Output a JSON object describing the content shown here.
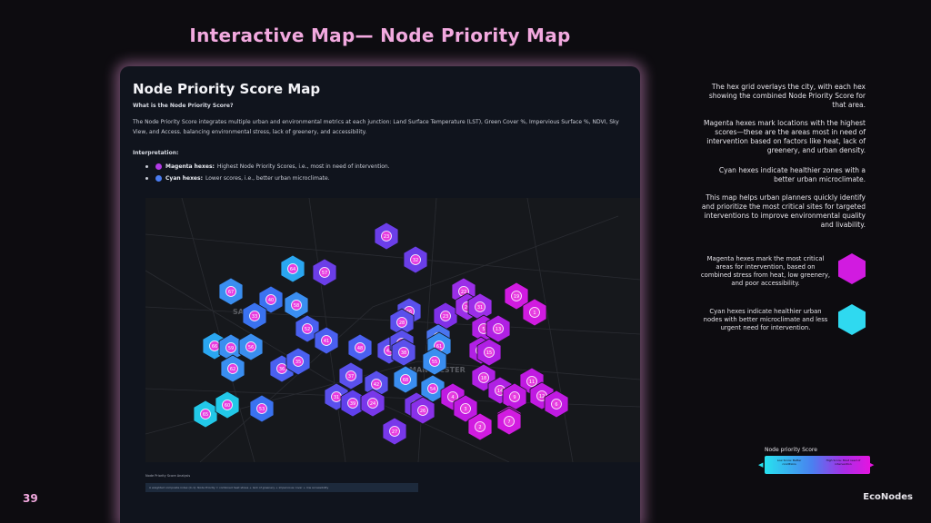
{
  "slide": {
    "title": "Interactive Map— Node Priority Map",
    "page_number": "39",
    "brand": "EcoNodes"
  },
  "panel": {
    "title": "Node Priority Score Map",
    "question": "What is the Node Priority Score?",
    "description": "The Node Priority Score integrates multiple urban and environmental metrics at each junction: Land Surface Temperature (LST), Green Cover %, Impervious Surface %, NDVI, Sky View, and Access. balancing environmental stress, lack of greenery, and accessibility.",
    "interpretation_heading": "Interpretation:",
    "interpretation": [
      {
        "label": "Magenta hexes:",
        "text": "Highest Node Priority Scores, i.e., most in need of intervention.",
        "color": "#d11be0"
      },
      {
        "label": "Cyan hexes:",
        "text": "Lower scores, i.e., better urban microclimate.",
        "color": "#4a7cf0"
      }
    ],
    "note_small": "Node Priority Score Analysis",
    "note_bar": "A weighted composite index (0–1): Node Priority = combined heat stress + lack of greenery + impervious cover + low accessibility"
  },
  "map": {
    "labels": [
      "SAL",
      "MANCHESTER"
    ],
    "hexes": [
      {
        "n": "23",
        "c": "#6b3ee8"
      },
      {
        "n": "32",
        "c": "#6b3ee8"
      },
      {
        "n": "64",
        "c": "#2aa6f0"
      },
      {
        "n": "57",
        "c": "#6b3ee8"
      },
      {
        "n": "22",
        "c": "#9b2ee8"
      },
      {
        "n": "19",
        "c": "#d11be0"
      },
      {
        "n": "1",
        "c": "#d11be0"
      },
      {
        "n": "67",
        "c": "#3a8ef0"
      },
      {
        "n": "40",
        "c": "#3a72f0"
      },
      {
        "n": "58",
        "c": "#3a8ef0"
      },
      {
        "n": "33",
        "c": "#3a72f0"
      },
      {
        "n": "52",
        "c": "#4a60f0"
      },
      {
        "n": "66",
        "c": "#5a50ec"
      },
      {
        "n": "28",
        "c": "#5a50ec"
      },
      {
        "n": "23",
        "c": "#8030e8"
      },
      {
        "n": "20",
        "c": "#9b2ee8"
      },
      {
        "n": "31",
        "c": "#9b2ee8"
      },
      {
        "n": "63",
        "c": "#4a74f0"
      },
      {
        "n": "5",
        "c": "#b020e4"
      },
      {
        "n": "13",
        "c": "#b020e4"
      },
      {
        "n": "66",
        "c": "#2aa6f0"
      },
      {
        "n": "59",
        "c": "#3a8ef0"
      },
      {
        "n": "56",
        "c": "#3a8ef0"
      },
      {
        "n": "41",
        "c": "#4a60f0"
      },
      {
        "n": "48",
        "c": "#4a60f0"
      },
      {
        "n": "45",
        "c": "#5a50ec"
      },
      {
        "n": "47",
        "c": "#5a50ec"
      },
      {
        "n": "38",
        "c": "#5a50ec"
      },
      {
        "n": "61",
        "c": "#3a8ef0"
      },
      {
        "n": "17",
        "c": "#b020e4"
      },
      {
        "n": "15",
        "c": "#b020e4"
      },
      {
        "n": "62",
        "c": "#3a8ef0"
      },
      {
        "n": "36",
        "c": "#4a60f0"
      },
      {
        "n": "35",
        "c": "#4a60f0"
      },
      {
        "n": "37",
        "c": "#5a50ec"
      },
      {
        "n": "55",
        "c": "#3a8ef0"
      },
      {
        "n": "18",
        "c": "#b020e4"
      },
      {
        "n": "11",
        "c": "#c01ae2"
      },
      {
        "n": "42",
        "c": "#5a50ec"
      },
      {
        "n": "68",
        "c": "#3a8ef0"
      },
      {
        "n": "54",
        "c": "#3a8ef0"
      },
      {
        "n": "14",
        "c": "#b020e4"
      },
      {
        "n": "12",
        "c": "#c01ae2"
      },
      {
        "n": "31",
        "c": "#5a50ec"
      },
      {
        "n": "39",
        "c": "#6040ec"
      },
      {
        "n": "24",
        "c": "#7838ea"
      },
      {
        "n": "4",
        "c": "#c01ae2"
      },
      {
        "n": "9",
        "c": "#c01ae2"
      },
      {
        "n": "6",
        "c": "#c01ae2"
      },
      {
        "n": "8",
        "c": "#d11be0"
      },
      {
        "n": "65",
        "c": "#22c8e8"
      },
      {
        "n": "60",
        "c": "#22c8e8"
      },
      {
        "n": "53",
        "c": "#3a72f0"
      },
      {
        "n": "25",
        "c": "#7838ea"
      },
      {
        "n": "26",
        "c": "#8a30e8"
      },
      {
        "n": "3",
        "c": "#c01ae2"
      },
      {
        "n": "7",
        "c": "#d11be0"
      },
      {
        "n": "2",
        "c": "#d11be0"
      },
      {
        "n": "27",
        "c": "#7838ea"
      }
    ]
  },
  "side": {
    "p1": "The hex grid overlays the city, with each hex showing the combined Node Priority Score for that area.",
    "p2": "Magenta hexes mark locations with the highest scores—these are the areas most in need of intervention based on factors like heat, lack of greenery, and urban density.",
    "p3": "Cyan hexes indicate healthier zones with a better urban microclimate.",
    "p4": "This map helps urban planners quickly identify and prioritize the most critical sites for targeted interventions to improve environmental quality and livability.",
    "legend_magenta": "Magenta hexes mark the most critical areas for intervention, based on combined stress from heat, low greenery, and poor accessibility.",
    "legend_cyan": "Cyan hexes indicate healthier urban nodes with better microclimate and less urgent need for intervention.",
    "colorbar_title": "Node priority Score",
    "colorbar_left": "Low Score: Better conditions",
    "colorbar_right": "High Score: Most need of intervention"
  },
  "colors": {
    "accent": "#f2a9df",
    "magenta": "#d11be0",
    "cyan": "#2fd9f0"
  }
}
